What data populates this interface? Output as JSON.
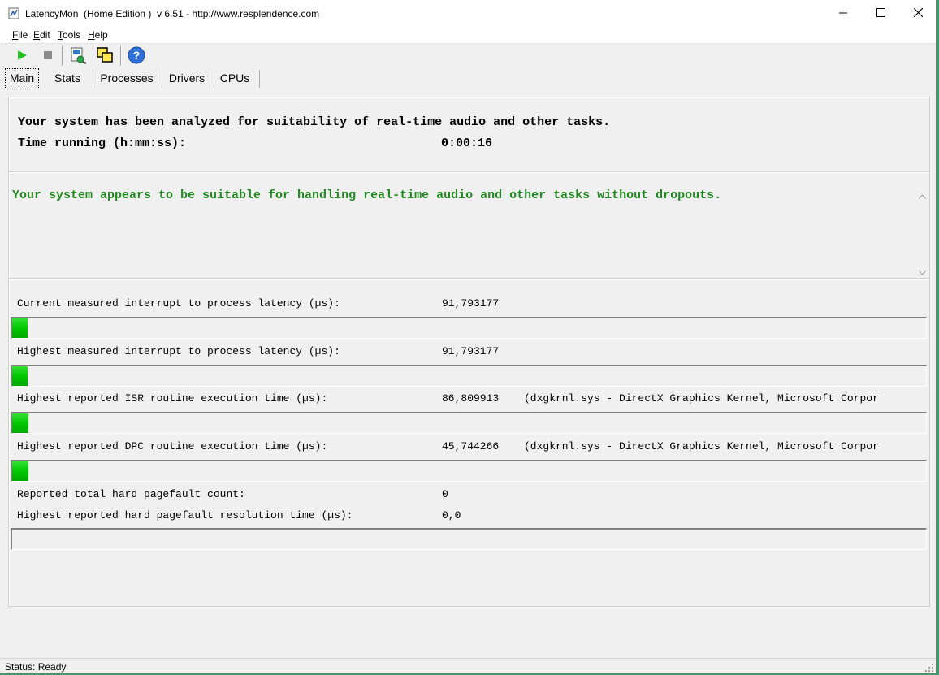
{
  "window": {
    "title": "LatencyMon  (Home Edition )  v 6.51 - http://www.resplendence.com"
  },
  "menu": {
    "items": [
      "File",
      "Edit",
      "Tools",
      "Help"
    ]
  },
  "toolbar": {
    "icons": [
      "play-icon",
      "stop-icon",
      "report-icon",
      "windows-icon",
      "help-icon"
    ]
  },
  "tabs": [
    "Main",
    "Stats",
    "Processes",
    "Drivers",
    "CPUs"
  ],
  "summary": {
    "analyzed_text": "Your system has been analyzed for suitability of real-time audio and other tasks.",
    "time_label": "Time running (h:mm:ss):",
    "time_value": "0:00:16"
  },
  "verdict": {
    "message": "Your system appears to be suitable for handling real-time audio and other tasks without dropouts.",
    "color": "#1e8a1e"
  },
  "stats": [
    {
      "label": "Current measured interrupt to process latency (µs):",
      "value": "91,793177",
      "note": "",
      "bar_fraction": 0.017
    },
    {
      "label": "Highest measured interrupt to process latency (µs):",
      "value": "91,793177",
      "note": "",
      "bar_fraction": 0.017
    },
    {
      "label": "Highest reported ISR routine execution time (µs):",
      "value": "86,809913",
      "note": "(dxgkrnl.sys - DirectX Graphics Kernel, Microsoft Corpor",
      "bar_fraction": 0.018
    },
    {
      "label": "Highest reported DPC routine execution time (µs):",
      "value": "45,744266",
      "note": "(dxgkrnl.sys - DirectX Graphics Kernel, Microsoft Corpor",
      "bar_fraction": 0.018
    }
  ],
  "pagefault": {
    "count_label": "Reported total hard pagefault count:",
    "count_value": "0",
    "time_label": "Highest reported hard pagefault resolution time (µs):",
    "time_value": "0,0",
    "bar_fraction": 0
  },
  "status": {
    "text": "Status: Ready"
  },
  "colors": {
    "accent_green": "#00c800"
  }
}
